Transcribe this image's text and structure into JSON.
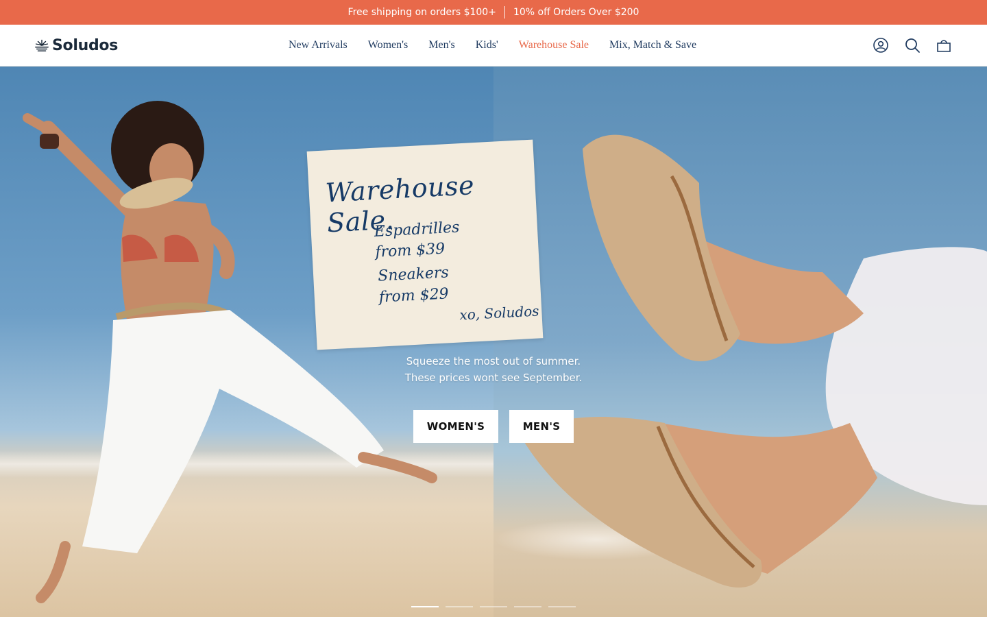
{
  "announcement": {
    "message_1": "Free shipping on orders $100+",
    "message_2": "10% off Orders Over $200"
  },
  "header": {
    "logo_text": "Soludos",
    "nav": [
      {
        "label": "New Arrivals"
      },
      {
        "label": "Women's"
      },
      {
        "label": "Men's"
      },
      {
        "label": "Kids'"
      },
      {
        "label": "Warehouse Sale"
      },
      {
        "label": "Mix, Match & Save"
      }
    ],
    "icons": [
      "account-icon",
      "search-icon",
      "cart-icon"
    ]
  },
  "hero": {
    "note": {
      "title": "Warehouse Sale.",
      "line_1": "Espadrilles",
      "line_2": "from $39",
      "line_3": "Sneakers",
      "line_4": "from $29",
      "signature": "xo, Soludos"
    },
    "subtitle_line_1": "Squeeze the most out of summer.",
    "subtitle_line_2": "These prices wont see September.",
    "cta_women": "WOMEN'S",
    "cta_men": "MEN'S",
    "slide_count": 5,
    "active_slide": 1
  },
  "colors": {
    "accent": "#e8694a",
    "nav_text": "#1f3a5f",
    "note_ink": "#163a66"
  }
}
